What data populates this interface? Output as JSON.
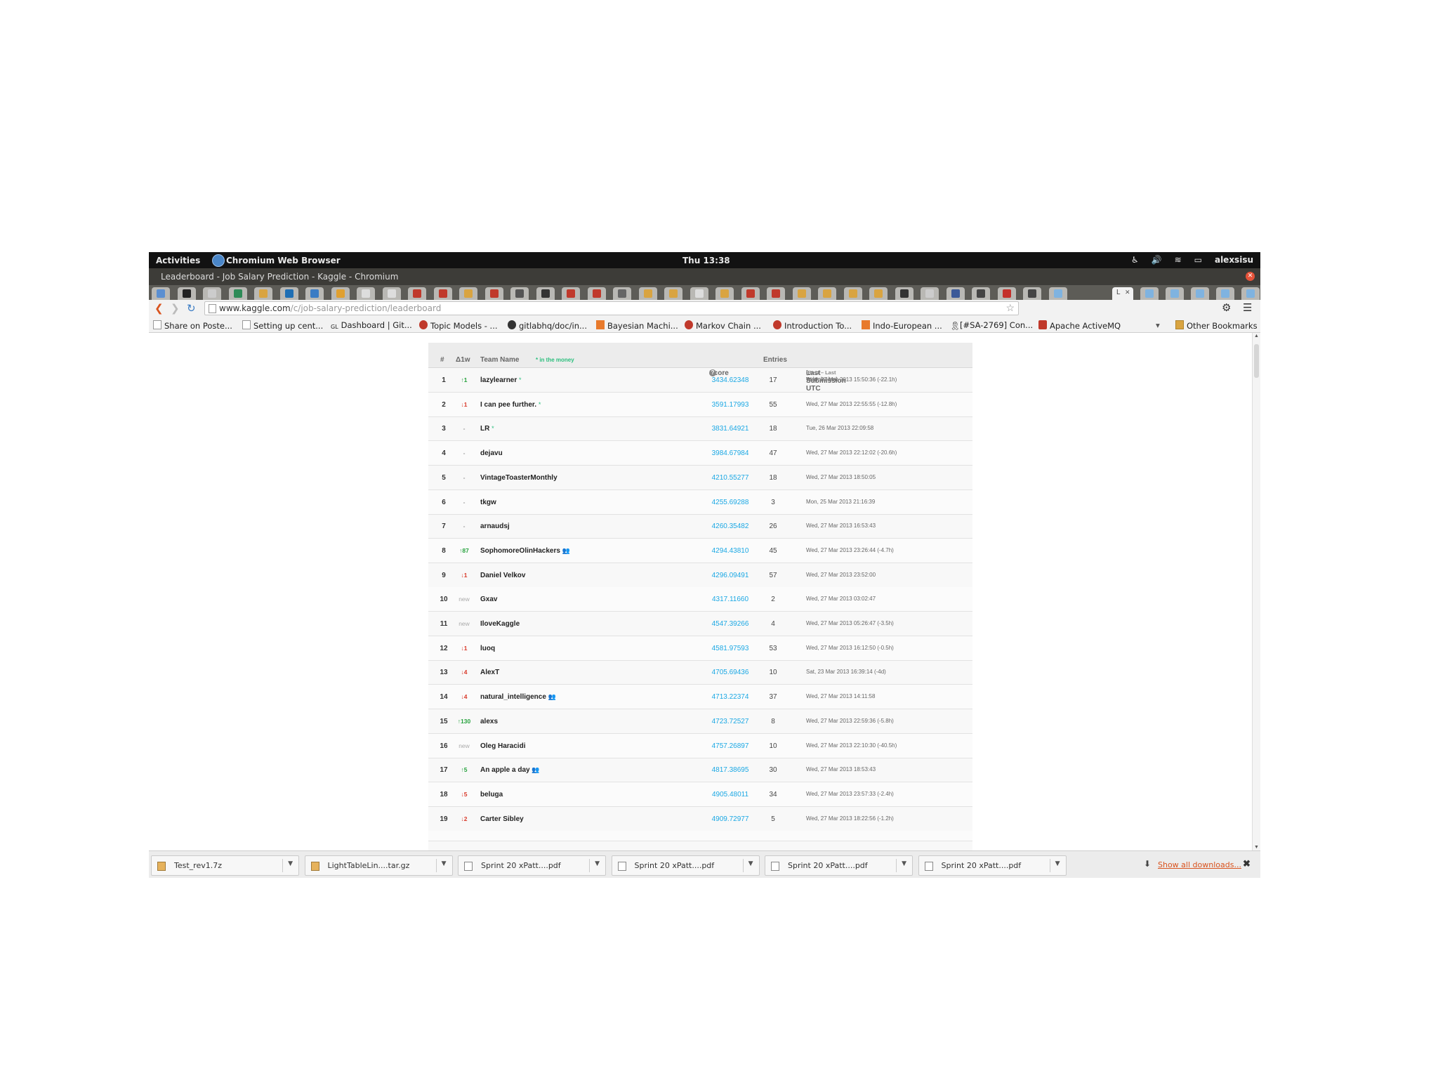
{
  "topbar": {
    "activities": "Activities",
    "app": "Chromium Web Browser",
    "clock": "Thu 13:38",
    "user": "alexsisu",
    "tray_icons": [
      "accessibility-icon",
      "volume-icon",
      "wifi-icon",
      "battery-icon"
    ]
  },
  "window": {
    "title": "Leaderboard - Job Salary Prediction - Kaggle - Chromium",
    "active_tab_label": "L"
  },
  "omnibox": {
    "host": "www.kaggle.com",
    "path": "/c/job-salary-prediction/leaderboard"
  },
  "bookmarks": [
    "Share on Poste...",
    "Setting up cent...",
    "Dashboard | Git...",
    "Topic Models - ...",
    "gitlabhq/doc/in...",
    "Bayesian Machi...",
    "Markov Chain ...",
    "Introduction To...",
    "Indo-European ...",
    "[#SA-2769] Con...",
    "Apache ActiveMQ"
  ],
  "other_bookmarks": "Other Bookmarks",
  "leaderboard": {
    "headers": {
      "rank": "#",
      "delta": "Δ1w",
      "team": "Team Name",
      "in_money": "* in the money",
      "score": "Score",
      "entries": "Entries",
      "last": "Last Submission UTC",
      "last_note": "(Best – Last Submission)"
    },
    "rows": [
      {
        "rank": "1",
        "delta": "↑1",
        "dir": "up",
        "team": "lazylearner",
        "money": "*",
        "score": "3434.62348",
        "entries": "17",
        "last": "Wed, 27 Mar 2013 15:50:36 (-22.1h)"
      },
      {
        "rank": "2",
        "delta": "↓1",
        "dir": "dn",
        "team": "I can pee further.",
        "money": "*",
        "score": "3591.17993",
        "entries": "55",
        "last": "Wed, 27 Mar 2013 22:55:55 (-12.8h)"
      },
      {
        "rank": "3",
        "delta": "-",
        "dir": "same",
        "team": "LR",
        "money": "*",
        "score": "3831.64921",
        "entries": "18",
        "last": "Tue, 26 Mar 2013 22:09:58"
      },
      {
        "rank": "4",
        "delta": "-",
        "dir": "same",
        "team": "dejavu",
        "money": "",
        "score": "3984.67984",
        "entries": "47",
        "last": "Wed, 27 Mar 2013 22:12:02 (-20.6h)"
      },
      {
        "rank": "5",
        "delta": "-",
        "dir": "same",
        "team": "VintageToasterMonthly",
        "money": "",
        "score": "4210.55277",
        "entries": "18",
        "last": "Wed, 27 Mar 2013 18:50:05"
      },
      {
        "rank": "6",
        "delta": "-",
        "dir": "same",
        "team": "tkgw",
        "money": "",
        "score": "4255.69288",
        "entries": "3",
        "last": "Mon, 25 Mar 2013 21:16:39"
      },
      {
        "rank": "7",
        "delta": "-",
        "dir": "same",
        "team": "arnaudsj",
        "money": "",
        "score": "4260.35482",
        "entries": "26",
        "last": "Wed, 27 Mar 2013 16:53:43"
      },
      {
        "rank": "8",
        "delta": "↑87",
        "dir": "up",
        "team": "SophomoreOlinHackers",
        "team_icon": true,
        "money": "",
        "score": "4294.43810",
        "entries": "45",
        "last": "Wed, 27 Mar 2013 23:26:44 (-4.7h)"
      },
      {
        "rank": "9",
        "delta": "↓1",
        "dir": "dn",
        "team": "Daniel Velkov",
        "money": "",
        "score": "4296.09491",
        "entries": "57",
        "last": "Wed, 27 Mar 2013 23:52:00"
      },
      {
        "rank": "10",
        "delta": "new",
        "dir": "nw",
        "team": "Gxav",
        "money": "",
        "score": "4317.11660",
        "entries": "2",
        "last": "Wed, 27 Mar 2013 03:02:47"
      },
      {
        "rank": "11",
        "delta": "new",
        "dir": "nw",
        "team": "IloveKaggle",
        "money": "",
        "score": "4547.39266",
        "entries": "4",
        "last": "Wed, 27 Mar 2013 05:26:47 (-3.5h)"
      },
      {
        "rank": "12",
        "delta": "↓1",
        "dir": "dn",
        "team": "luoq",
        "money": "",
        "score": "4581.97593",
        "entries": "53",
        "last": "Wed, 27 Mar 2013 16:12:50 (-0.5h)"
      },
      {
        "rank": "13",
        "delta": "↓4",
        "dir": "dn",
        "team": "AlexT",
        "money": "",
        "score": "4705.69436",
        "entries": "10",
        "last": "Sat, 23 Mar 2013 16:39:14 (-4d)"
      },
      {
        "rank": "14",
        "delta": "↓4",
        "dir": "dn",
        "team": "natural_intelligence",
        "team_icon": true,
        "money": "",
        "score": "4713.22374",
        "entries": "37",
        "last": "Wed, 27 Mar 2013 14:11:58"
      },
      {
        "rank": "15",
        "delta": "↑130",
        "dir": "up",
        "team": "alexs",
        "money": "",
        "score": "4723.72527",
        "entries": "8",
        "last": "Wed, 27 Mar 2013 22:59:36 (-5.8h)"
      },
      {
        "rank": "16",
        "delta": "new",
        "dir": "nw",
        "team": "Oleg Haracidi",
        "money": "",
        "score": "4757.26897",
        "entries": "10",
        "last": "Wed, 27 Mar 2013 22:10:30 (-40.5h)"
      },
      {
        "rank": "17",
        "delta": "↑5",
        "dir": "up",
        "team": "An apple a day",
        "team_icon": true,
        "money": "",
        "score": "4817.38695",
        "entries": "30",
        "last": "Wed, 27 Mar 2013 18:53:43"
      },
      {
        "rank": "18",
        "delta": "↓5",
        "dir": "dn",
        "team": "beluga",
        "money": "",
        "score": "4905.48011",
        "entries": "34",
        "last": "Wed, 27 Mar 2013 23:57:33 (-2.4h)"
      },
      {
        "rank": "19",
        "delta": "↓2",
        "dir": "dn",
        "team": "Carter Sibley",
        "money": "",
        "score": "4909.72977",
        "entries": "5",
        "last": "Wed, 27 Mar 2013 18:22:56 (-1.2h)"
      }
    ]
  },
  "downloads": [
    {
      "name": "Test_rev1.7z",
      "kind": "archive"
    },
    {
      "name": "LightTableLin....tar.gz",
      "kind": "archive"
    },
    {
      "name": "Sprint 20 xPatt....pdf",
      "kind": "pdf"
    },
    {
      "name": "Sprint 20 xPatt....pdf",
      "kind": "pdf"
    },
    {
      "name": "Sprint 20 xPatt....pdf",
      "kind": "pdf"
    },
    {
      "name": "Sprint 20 xPatt....pdf",
      "kind": "pdf"
    }
  ],
  "show_all_downloads": "Show all downloads...",
  "colors": {
    "score_link": "#1ba8e4",
    "up": "#27a23e",
    "down": "#d93a2b",
    "in_money": "#2bbf7d",
    "show_all": "#d9531e"
  }
}
